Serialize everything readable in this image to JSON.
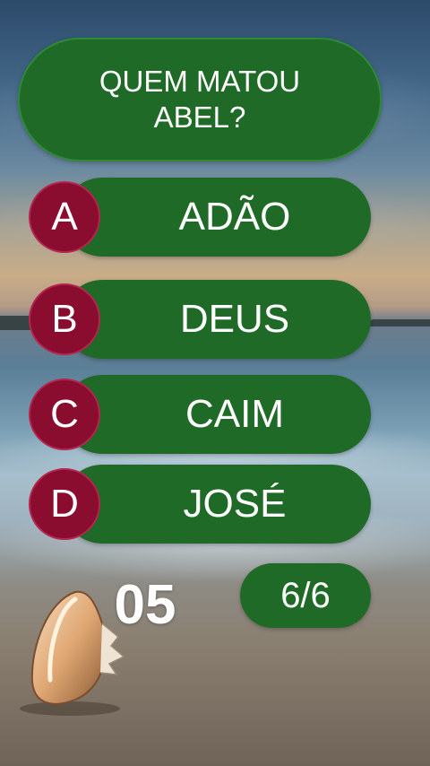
{
  "question": {
    "line1": "QUEM MATOU",
    "line2": "ABEL?"
  },
  "answers": [
    {
      "letter": "A",
      "text": "ADÃO"
    },
    {
      "letter": "B",
      "text": "DEUS"
    },
    {
      "letter": "C",
      "text": "CAIM"
    },
    {
      "letter": "D",
      "text": "JOSÉ"
    }
  ],
  "timer": "05",
  "progress": "6/6",
  "colors": {
    "panel_green": "#1f6a27",
    "letter_maroon": "#8a0c2e",
    "text": "#ffffff"
  },
  "icons": {
    "background": "beach-seashell-image"
  }
}
